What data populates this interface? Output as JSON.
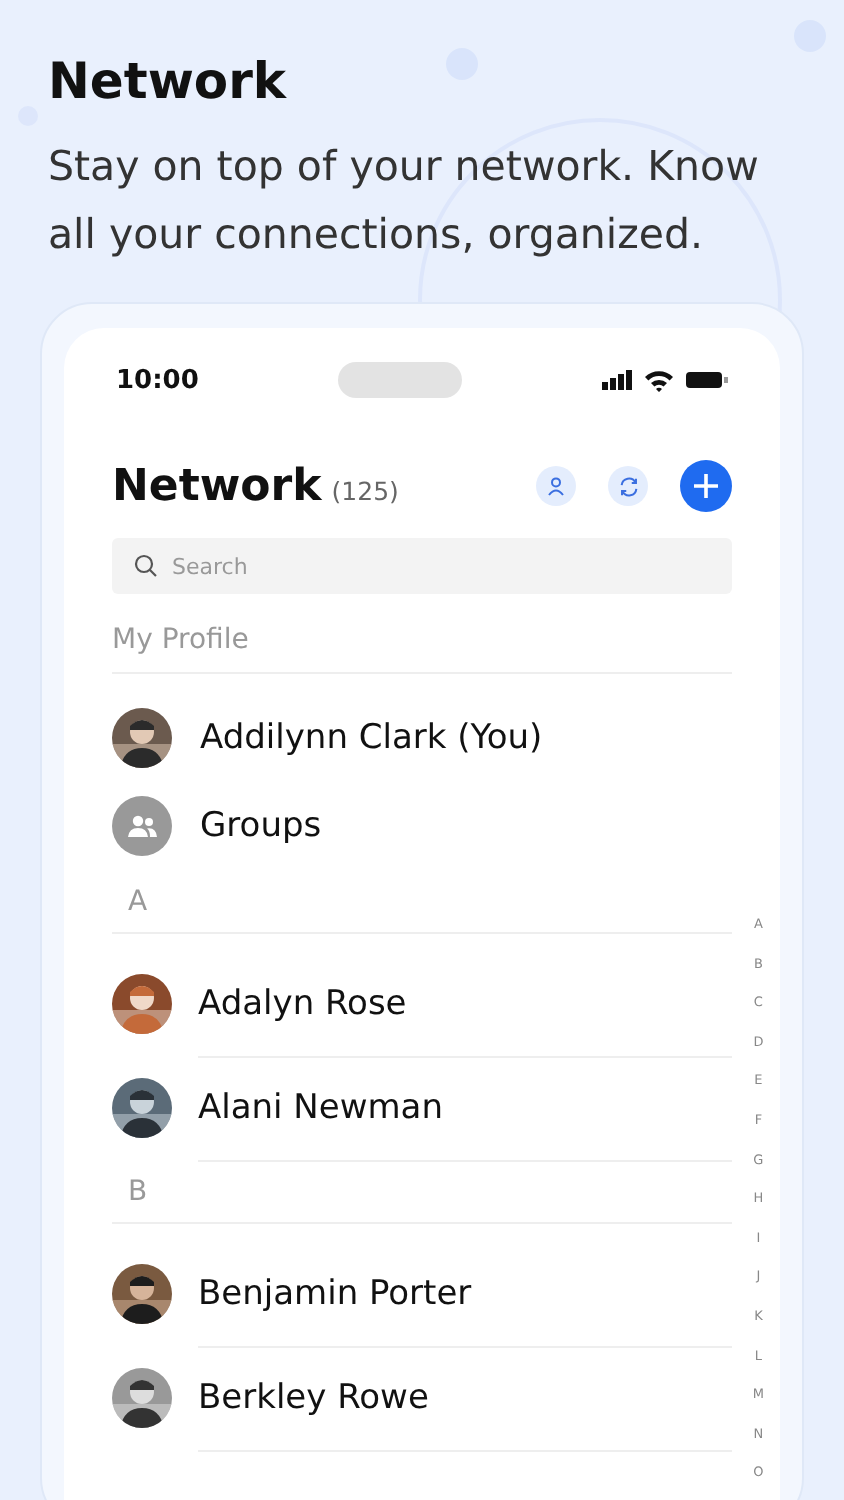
{
  "headline": "Network",
  "subtitle": "Stay on top of your network. Know all your connections, organized.",
  "status_bar": {
    "time": "10:00"
  },
  "header": {
    "title": "Network",
    "count": "(125)"
  },
  "search": {
    "placeholder": "Search"
  },
  "profile_section": {
    "label": "My Profile",
    "items": [
      {
        "kind": "person",
        "name": "Addilynn Clark (You)"
      },
      {
        "kind": "groups",
        "name": "Groups"
      }
    ]
  },
  "sections": [
    {
      "letter": "A",
      "contacts": [
        {
          "name": "Adalyn Rose"
        },
        {
          "name": "Alani Newman"
        }
      ]
    },
    {
      "letter": "B",
      "contacts": [
        {
          "name": "Benjamin Porter"
        },
        {
          "name": "Berkley Rowe"
        }
      ]
    }
  ],
  "index_letters": [
    "A",
    "B",
    "C",
    "D",
    "E",
    "F",
    "G",
    "H",
    "I",
    "J",
    "K",
    "L",
    "M",
    "N",
    "O"
  ]
}
